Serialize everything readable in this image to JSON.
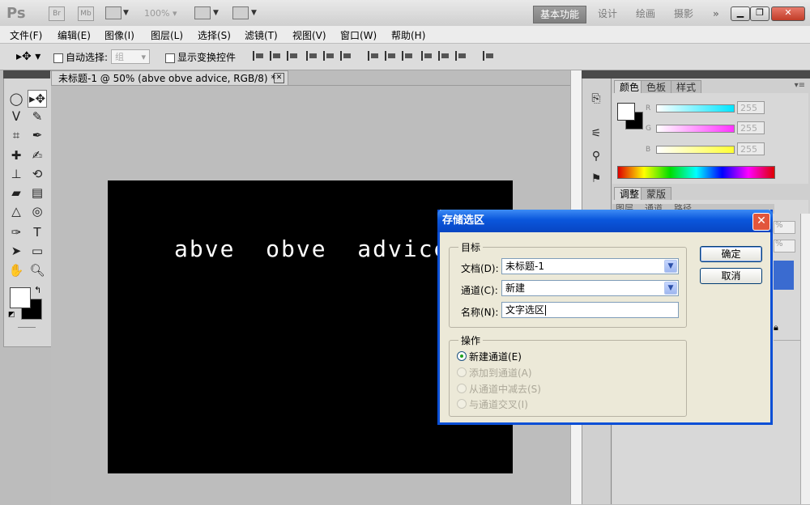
{
  "app": {
    "logo": "Ps",
    "launch_btns": [
      "Br",
      "Mb"
    ],
    "zoom": "100%",
    "workspaces": [
      "基本功能",
      "设计",
      "绘画",
      "摄影"
    ],
    "more": "»"
  },
  "menu": [
    "文件(F)",
    "编辑(E)",
    "图像(I)",
    "图层(L)",
    "选择(S)",
    "滤镜(T)",
    "视图(V)",
    "窗口(W)",
    "帮助(H)"
  ],
  "options": {
    "auto_select_label": "自动选择:",
    "group_value": "组",
    "show_transform_label": "显示变换控件"
  },
  "document": {
    "tab_title": "未标题-1 @ 50% (abve  obve  advice, RGB/8) *",
    "canvas_text": "abve  obve  advice"
  },
  "panels": {
    "color_tabs": [
      "颜色",
      "色板",
      "样式"
    ],
    "channels": [
      {
        "label": "R",
        "value": "255",
        "color": "#00e5ff"
      },
      {
        "label": "G",
        "value": "255",
        "color": "#ff33ff"
      },
      {
        "label": "B",
        "value": "255",
        "color": "#ffff33"
      }
    ],
    "adjust_tabs": [
      "调整",
      "蒙版"
    ],
    "layer_tabs": [
      "图层",
      "通道",
      "路径"
    ],
    "pct_symbol": "%"
  },
  "dialog": {
    "title": "存储选区",
    "target_legend": "目标",
    "doc_label": "文档(D):",
    "doc_value": "未标题-1",
    "channel_label": "通道(C):",
    "channel_value": "新建",
    "name_label": "名称(N):",
    "name_value": "文字选区",
    "op_legend": "操作",
    "ops": [
      {
        "label": "新建通道(E)",
        "enabled": true,
        "checked": true
      },
      {
        "label": "添加到通道(A)",
        "enabled": false,
        "checked": false
      },
      {
        "label": "从通道中减去(S)",
        "enabled": false,
        "checked": false
      },
      {
        "label": "与通道交叉(I)",
        "enabled": false,
        "checked": false
      }
    ],
    "ok": "确定",
    "cancel": "取消"
  },
  "colors": {
    "dialog_title": "#0a56dc",
    "dialog_body": "#ece9d8",
    "canvas": "#000000",
    "canvas_text": "#ffffff",
    "workspace_active": "#8a8a8a"
  },
  "icons": {
    "move_tool": "move-tool-icon",
    "close": "close-icon"
  }
}
